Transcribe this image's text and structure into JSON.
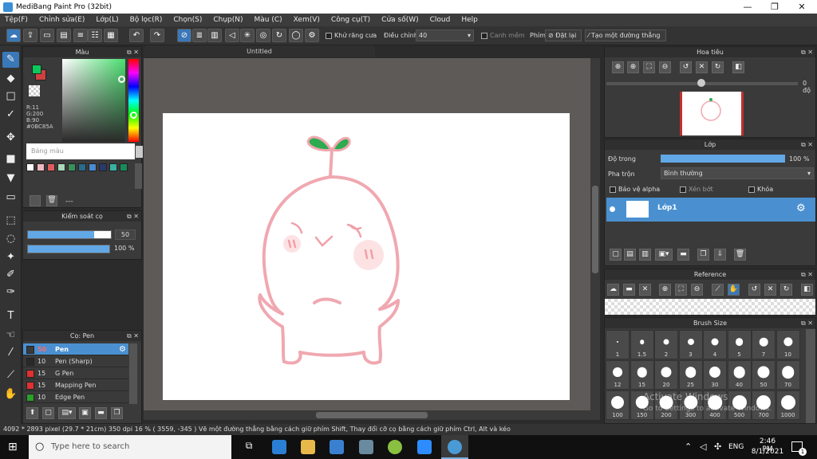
{
  "window": {
    "title": "MediBang Paint Pro (32bit)",
    "minimize": "—",
    "maximize": "❐",
    "close": "✕"
  },
  "menu": [
    "Tệp(F)",
    "Chỉnh sửa(E)",
    "Lớp(L)",
    "Bộ lọc(R)",
    "Chọn(S)",
    "Chụp(N)",
    "Màu (C)",
    "Xem(V)",
    "Công cụ(T)",
    "Cửa số(W)",
    "Cloud",
    "Help"
  ],
  "toolbar": {
    "antialias_label": "Khử răng cưa",
    "adjust_label": "Điều chỉnh",
    "adjust_value": "40",
    "edge_label": "Canh mềm",
    "key_label": "Phím",
    "reset_label": "Đặt lại",
    "line_label": "Tạo một đường thẳng"
  },
  "color_panel": {
    "title": "Màu",
    "r": "R:11",
    "g": "G:200",
    "b": "B:90",
    "hex": "#0BC85A",
    "palette_placeholder": "Bảng màu",
    "dots": "---",
    "swatches": [
      "#ffffff",
      "#f2b8c0",
      "#e05c5c",
      "#a8d8b8",
      "#3a8f5a",
      "#2a6a8a",
      "#4a8ad0",
      "#2a3a6a",
      "#3ab0a0",
      "#1a8a5a"
    ]
  },
  "brush_control": {
    "title": "Kiểm soát cọ",
    "size": "50",
    "opacity": "100 %",
    "size_fill": 0.8,
    "opacity_fill": 1.0
  },
  "brush_list": {
    "title": "Cọ: Pen",
    "items": [
      {
        "size": "50",
        "name": "Pen",
        "color": "#3a3a3a",
        "selected": true
      },
      {
        "size": "10",
        "name": "Pen (Sharp)",
        "color": "#2a2a2a",
        "selected": false
      },
      {
        "size": "15",
        "name": "G Pen",
        "color": "#e03030",
        "selected": false
      },
      {
        "size": "15",
        "name": "Mapping Pen",
        "color": "#e03030",
        "selected": false
      },
      {
        "size": "10",
        "name": "Edge Pen",
        "color": "#2aa02a",
        "selected": false
      }
    ]
  },
  "document": {
    "tab": "Untitled"
  },
  "navigator": {
    "title": "Hoa tiêu",
    "angle": "0 độ"
  },
  "layer_panel": {
    "title": "Lớp",
    "opacity_label": "Độ trong",
    "opacity_value": "100 %",
    "blend_label": "Pha trộn",
    "blend_value": "Bình thường",
    "protect_alpha": "Bảo vệ alpha",
    "clip": "Xén bớt",
    "lock": "Khóa",
    "layer_name": "Lớp1"
  },
  "reference": {
    "title": "Reference"
  },
  "brush_size": {
    "title": "Brush Size",
    "sizes": [
      "1",
      "1.5",
      "2",
      "3",
      "4",
      "5",
      "7",
      "10",
      "12",
      "15",
      "20",
      "25",
      "30",
      "40",
      "50",
      "70",
      "100",
      "150",
      "200",
      "300",
      "400",
      "500",
      "700",
      "1000"
    ]
  },
  "watermark": {
    "line1": "Activate Windows",
    "line2": "Go to Settings to activate Windows."
  },
  "status": {
    "text": "4092 * 2893 pixel   (29.7 * 21cm)   350 dpi   16 %   ( 3559, -345 )   Vẽ một đường thẳng bằng cách giữ phím Shift, Thay đổi cỡ cọ bằng cách giữ phím Ctrl, Alt và kéo"
  },
  "taskbar": {
    "search": "Type here to search",
    "lang": "ENG",
    "time": "2:46 PM",
    "date": "8/1/2021",
    "notif": "1"
  }
}
